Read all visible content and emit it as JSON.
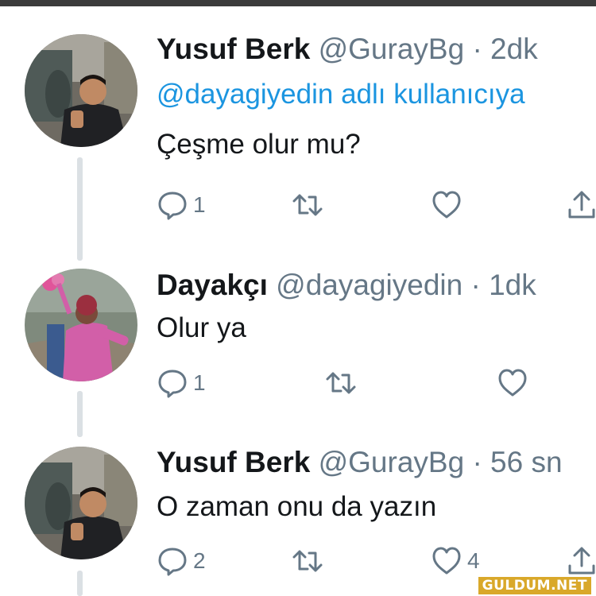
{
  "colors": {
    "link": "#1b95e0",
    "muted": "#657786",
    "text": "#14171a",
    "thread": "#dbe0e4"
  },
  "tweets": [
    {
      "name": "Yusuf Berk",
      "handle": "@GurayBg",
      "sep": "·",
      "time": "2dk",
      "reply_to": "@dayagiyedin adlı kullanıcıya",
      "text": "Çeşme olur mu?",
      "reply_count": "1",
      "retweet_count": "",
      "like_count": ""
    },
    {
      "name": "Dayakçı",
      "handle": "@dayagiyedin",
      "sep": "·",
      "time": "1dk",
      "text": "Olur ya",
      "reply_count": "1",
      "retweet_count": "",
      "like_count": ""
    },
    {
      "name": "Yusuf Berk",
      "handle": "@GurayBg",
      "sep": "·",
      "time": "56 sn",
      "text": "O zaman onu da yazın",
      "reply_count": "2",
      "retweet_count": "",
      "like_count": "4"
    }
  ],
  "icons": [
    "reply-icon",
    "retweet-icon",
    "like-icon",
    "share-icon"
  ],
  "watermark": "GULDUM.NET"
}
